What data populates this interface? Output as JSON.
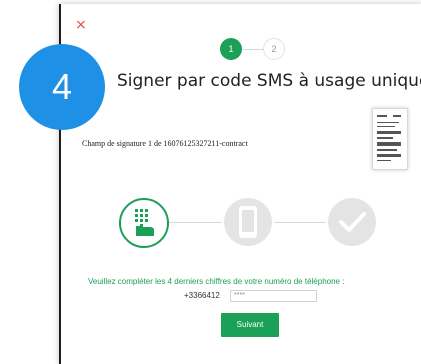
{
  "modal": {
    "close_glyph": "×",
    "steps": [
      "1",
      "2"
    ],
    "badge_number": "4",
    "title": "Signer par code SMS à usage unique",
    "signature_field_label": "Champ de signature 1 de 16076125327211-contract",
    "instruction": "Veuillez compléter les 4 derniers chiffres de votre numéro de téléphone :",
    "phone_prefix": "+3366412",
    "digits_value": "****",
    "submit_label": "Suivant"
  },
  "icons": {
    "close": "close-icon",
    "keypad": "keypad-phone-icon",
    "mobile": "mobile-icon",
    "check": "check-icon",
    "document": "document-thumbnail"
  },
  "colors": {
    "accent": "#1aa057",
    "badge": "#1e90e6",
    "close": "#e04b4b",
    "inactive": "#e4e4e4"
  }
}
